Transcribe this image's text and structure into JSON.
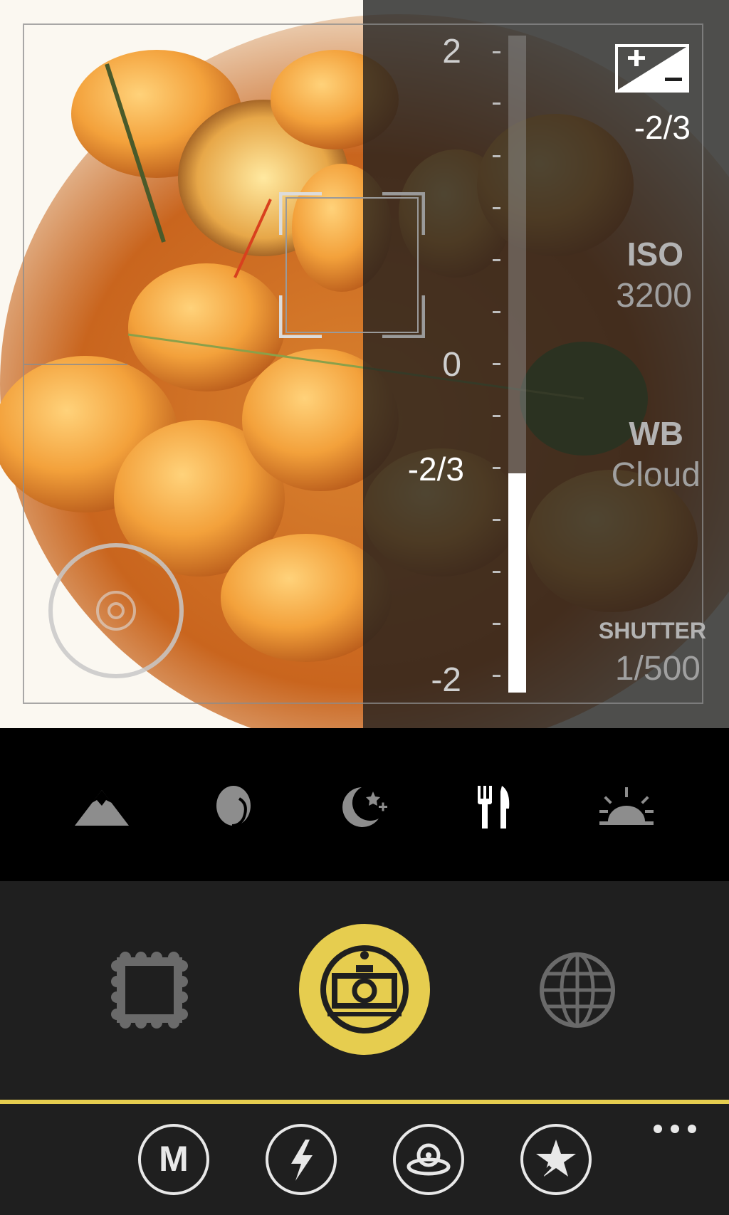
{
  "viewfinder": {
    "subject_image": "shrimp-dish-photo",
    "exposure": {
      "scale_labels": [
        "2",
        "0",
        "-2"
      ],
      "current_label": "-2/3",
      "current_value": -0.667,
      "min": -2,
      "max": 2
    },
    "settings": {
      "ev_icon": "exposure-compensation-icon",
      "ev_value": "-2/3",
      "iso_label": "ISO",
      "iso_value": "3200",
      "wb_label": "WB",
      "wb_value": "Cloud",
      "shutter_label": "SHUTTER",
      "shutter_value": "1/500"
    }
  },
  "scene_modes": [
    {
      "icon": "mountain-landscape-icon",
      "selected": false
    },
    {
      "icon": "portrait-icon",
      "selected": false
    },
    {
      "icon": "night-moon-stars-icon",
      "selected": false
    },
    {
      "icon": "food-fork-knife-icon",
      "selected": true
    },
    {
      "icon": "sunset-icon",
      "selected": false
    }
  ],
  "capture_modes": [
    {
      "icon": "frame-stamp-icon",
      "selected": false
    },
    {
      "icon": "camera-icon",
      "selected": true
    },
    {
      "icon": "globe-icon",
      "selected": false
    }
  ],
  "app_bar": {
    "buttons": [
      {
        "icon": "manual-m-icon",
        "label": "M"
      },
      {
        "icon": "flash-icon"
      },
      {
        "icon": "self-timer-icon"
      },
      {
        "icon": "effects-star-icon"
      }
    ],
    "more_icon": "ellipsis-icon"
  },
  "colors": {
    "accent": "#e6cd4f",
    "panel": "#1f1f1f",
    "background": "#000000"
  }
}
